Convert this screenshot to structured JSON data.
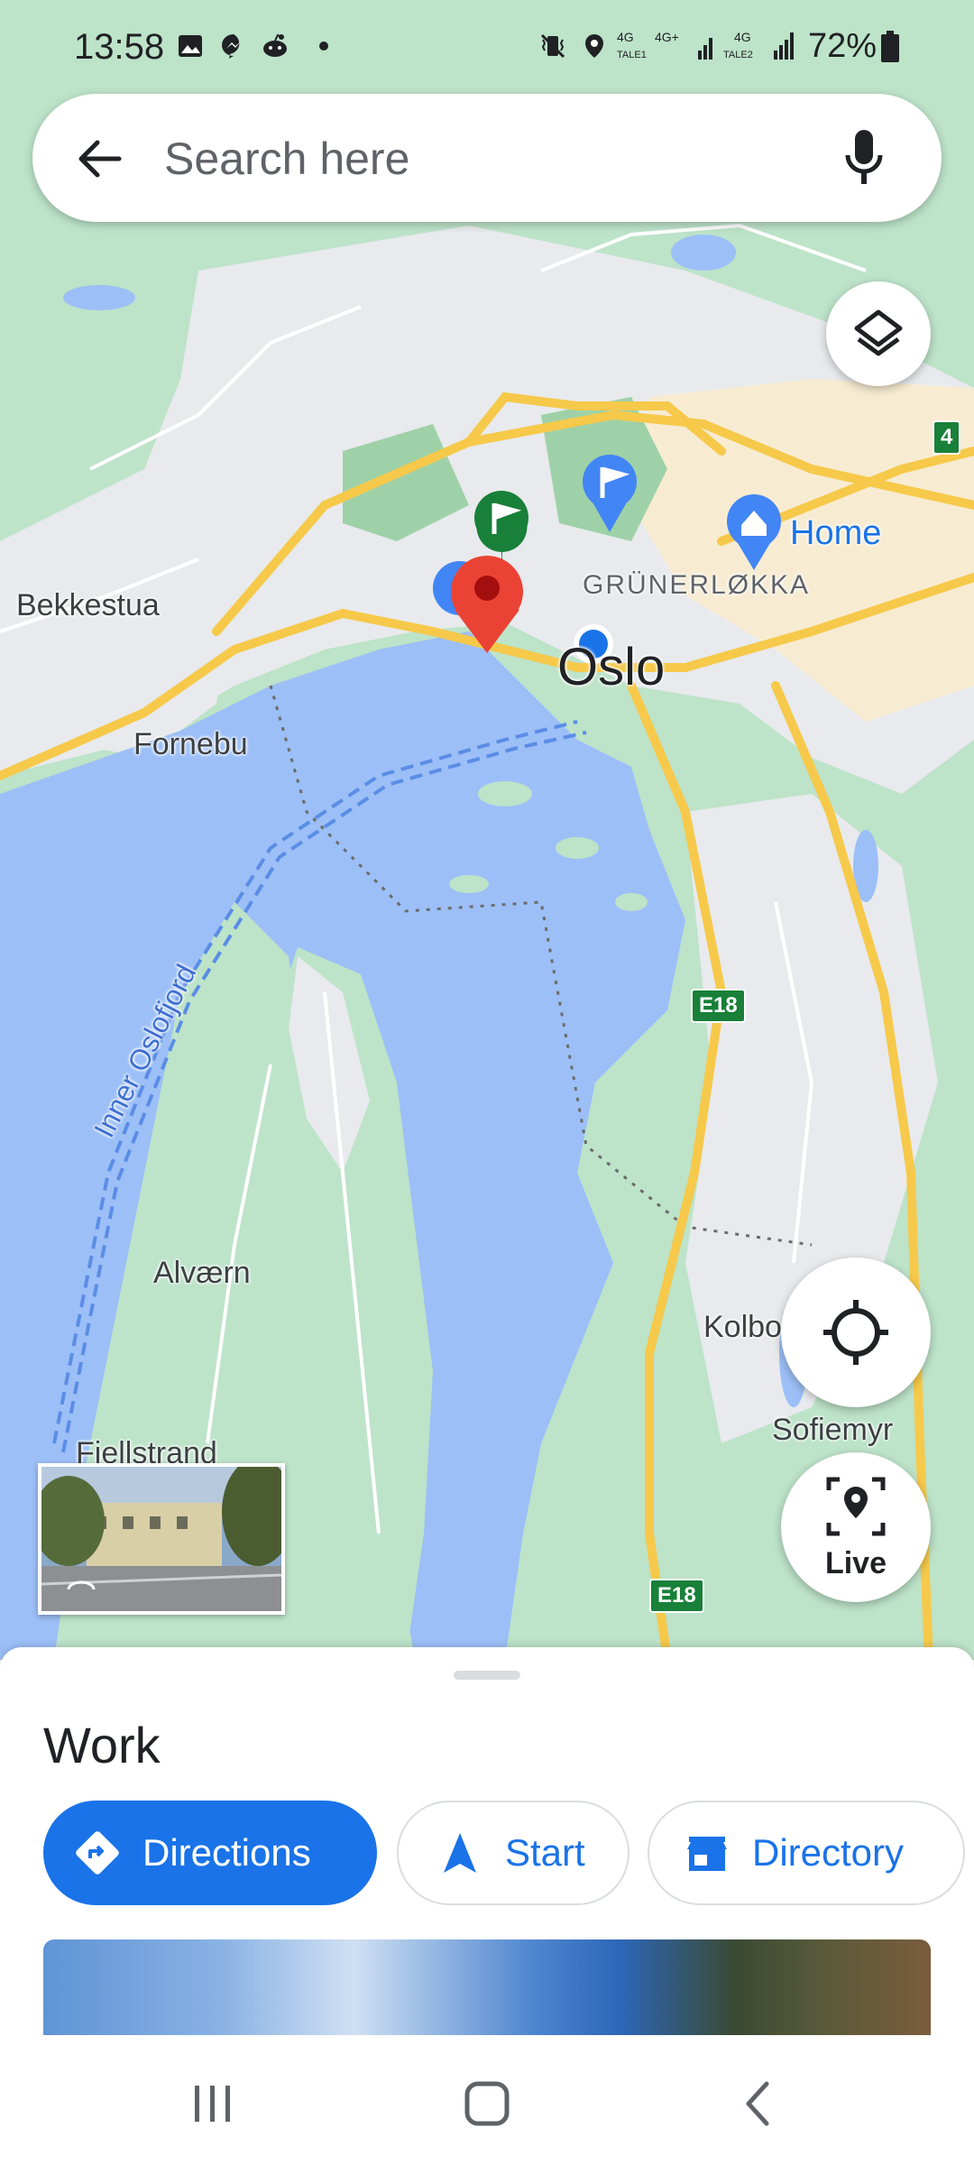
{
  "status_bar": {
    "time": "13:58",
    "battery": "72%",
    "left_icons": [
      "gallery-icon",
      "messenger-icon",
      "reddit-icon",
      "dot-icon"
    ],
    "right_icons": [
      "vibrate-icon",
      "location-icon",
      "signal-4g-sim1-icon",
      "signal-4g-sim2-icon",
      "battery-icon"
    ]
  },
  "search": {
    "placeholder": "Search here",
    "back_icon": "arrow-back-icon",
    "mic_icon": "microphone-icon"
  },
  "map": {
    "labels": {
      "city": "Oslo",
      "district": "GRÜNERLØKKA",
      "home": "Home",
      "bekkestua": "Bekkestua",
      "fornebu": "Fornebu",
      "alvaern": "Alværn",
      "fiellstrand": "Fiellstrand",
      "kolbotn": "Kolbo",
      "sofiemyr": "Sofiemyr",
      "fjord": "Inner Oslofjord"
    },
    "road_shields": {
      "e18_a": "E18",
      "e18_b": "E18",
      "r4": "4"
    },
    "markers": [
      "red-pin-icon",
      "green-flag-pin-icon",
      "blue-flag-pin-icon",
      "home-pin-icon",
      "blue-dot-location-icon"
    ]
  },
  "controls": {
    "layers_icon": "layers-icon",
    "locate_icon": "my-location-icon",
    "live_label": "Live"
  },
  "sheet": {
    "title": "Work",
    "buttons": {
      "directions": "Directions",
      "start": "Start",
      "directory": "Directory"
    }
  },
  "nav_bar": {
    "icons": [
      "recent-apps-icon",
      "home-button-icon",
      "back-icon"
    ]
  },
  "colors": {
    "accent": "#1a73e8",
    "water": "#9cbff7",
    "park": "#bde3c9",
    "road": "#f6c94a",
    "pin_red": "#ea4335",
    "pin_green": "#188038"
  }
}
